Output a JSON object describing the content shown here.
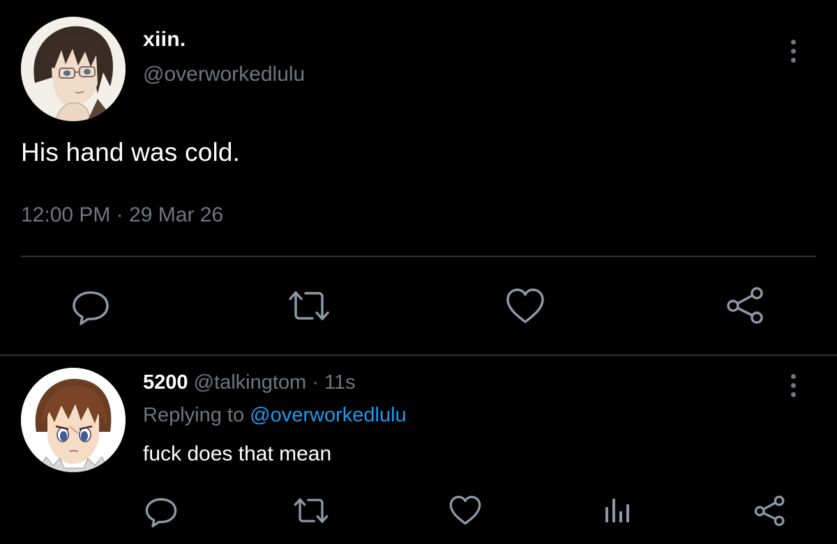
{
  "main_tweet": {
    "display_name": "xiin.",
    "handle": "@overworkedlulu",
    "text": "His hand was cold.",
    "timestamp": "12:00 PM · 29 Mar 26",
    "avatar_icon": "anime-boy-with-glasses-avatar"
  },
  "reply": {
    "display_name": "5200",
    "handle": "@talkingtom",
    "separator": "·",
    "age": "11s",
    "replying_to_prefix": "Replying to",
    "replying_to_handle": "@overworkedlulu",
    "text": "fuck does that mean",
    "avatar_icon": "anime-brown-hair-boy-avatar"
  },
  "icons": {
    "reply": "speech-bubble-icon",
    "retweet": "retweet-arrows-icon",
    "like": "heart-icon",
    "share": "share-nodes-icon",
    "analytics": "bar-chart-icon",
    "more": "vertical-dots-icon"
  },
  "colors": {
    "background": "#000000",
    "primary_text": "#ffffff",
    "secondary_text": "#71767b",
    "link": "#1d9bf0",
    "divider": "#2f3336"
  }
}
